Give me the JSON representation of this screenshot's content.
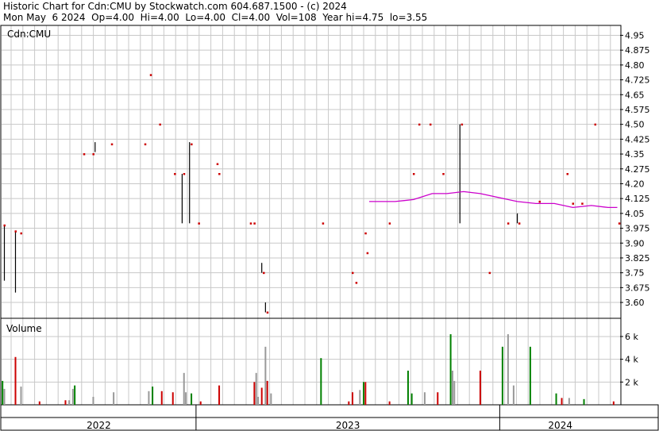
{
  "header": {
    "line1": "Historic Chart for Cdn:CMU by Stockwatch.com 604.687.1500 - (c) 2024",
    "line2": "Mon May  6 2024  Op=4.00  Hi=4.00  Lo=4.00  Cl=4.00  Vol=108  Year hi=4.75  lo=3.55"
  },
  "colors": {
    "up": "#008000",
    "down": "#cc0000",
    "neutral": "#999999",
    "price_bar": "#000000",
    "price_dot": "#cc0000",
    "moving_average": "#cc00cc",
    "grid": "#c8c8c8"
  },
  "chart_data": {
    "type": "bar",
    "symbol_label": "Cdn:CMU",
    "price_panel": {
      "ylim": [
        3.52,
        5.0
      ],
      "yticks": [
        "3.60",
        "3.675",
        "3.75",
        "3.825",
        "3.90",
        "3.975",
        "4.05",
        "4.125",
        "4.20",
        "4.275",
        "4.35",
        "4.425",
        "4.50",
        "4.575",
        "4.65",
        "4.725",
        "4.80",
        "4.875",
        "4.95"
      ],
      "bars": [
        {
          "idx": 1,
          "high": 3.99,
          "low": 3.71
        },
        {
          "idx": 7,
          "high": 3.96,
          "low": 3.65
        },
        {
          "idx": 50,
          "high": 4.41,
          "low": 4.36
        },
        {
          "idx": 97,
          "high": 4.25,
          "low": 4.0
        },
        {
          "idx": 101,
          "high": 4.41,
          "low": 4.0
        },
        {
          "idx": 140,
          "high": 3.8,
          "low": 3.75
        },
        {
          "idx": 142,
          "high": 3.6,
          "low": 3.55
        },
        {
          "idx": 247,
          "high": 4.5,
          "low": 4.0
        },
        {
          "idx": 278,
          "high": 4.05,
          "low": 4.0
        }
      ],
      "closes": [
        {
          "idx": 1,
          "close": 3.99
        },
        {
          "idx": 7,
          "close": 3.96
        },
        {
          "idx": 10,
          "close": 3.95
        },
        {
          "idx": 44,
          "close": 4.35
        },
        {
          "idx": 49,
          "close": 4.35
        },
        {
          "idx": 59,
          "close": 4.4
        },
        {
          "idx": 77,
          "close": 4.4
        },
        {
          "idx": 80,
          "close": 4.75
        },
        {
          "idx": 85,
          "close": 4.5
        },
        {
          "idx": 93,
          "close": 4.25
        },
        {
          "idx": 98,
          "close": 4.25
        },
        {
          "idx": 102,
          "close": 4.4
        },
        {
          "idx": 106,
          "close": 4.0
        },
        {
          "idx": 116,
          "close": 4.3
        },
        {
          "idx": 117,
          "close": 4.25
        },
        {
          "idx": 134,
          "close": 4.0
        },
        {
          "idx": 136,
          "close": 4.0
        },
        {
          "idx": 141,
          "close": 3.75
        },
        {
          "idx": 143,
          "close": 3.55
        },
        {
          "idx": 173,
          "close": 4.0
        },
        {
          "idx": 189,
          "close": 3.75
        },
        {
          "idx": 191,
          "close": 3.7
        },
        {
          "idx": 196,
          "close": 3.95
        },
        {
          "idx": 197,
          "close": 3.85
        },
        {
          "idx": 209,
          "close": 4.0
        },
        {
          "idx": 222,
          "close": 4.25
        },
        {
          "idx": 225,
          "close": 4.5
        },
        {
          "idx": 231,
          "close": 4.5
        },
        {
          "idx": 238,
          "close": 4.25
        },
        {
          "idx": 248,
          "close": 4.5
        },
        {
          "idx": 263,
          "close": 3.75
        },
        {
          "idx": 273,
          "close": 4.0
        },
        {
          "idx": 279,
          "close": 4.0
        },
        {
          "idx": 290,
          "close": 4.11
        },
        {
          "idx": 305,
          "close": 4.25
        },
        {
          "idx": 308,
          "close": 4.1
        },
        {
          "idx": 313,
          "close": 4.1
        },
        {
          "idx": 320,
          "close": 4.5
        },
        {
          "idx": 333,
          "close": 4.0
        }
      ],
      "moving_average": [
        {
          "idx": 198,
          "value": 4.11
        },
        {
          "idx": 212,
          "value": 4.11
        },
        {
          "idx": 222,
          "value": 4.12
        },
        {
          "idx": 232,
          "value": 4.15
        },
        {
          "idx": 240,
          "value": 4.15
        },
        {
          "idx": 249,
          "value": 4.16
        },
        {
          "idx": 258,
          "value": 4.15
        },
        {
          "idx": 268,
          "value": 4.13
        },
        {
          "idx": 278,
          "value": 4.11
        },
        {
          "idx": 288,
          "value": 4.1
        },
        {
          "idx": 298,
          "value": 4.1
        },
        {
          "idx": 308,
          "value": 4.08
        },
        {
          "idx": 318,
          "value": 4.09
        },
        {
          "idx": 327,
          "value": 4.08
        },
        {
          "idx": 332,
          "value": 4.08
        }
      ]
    },
    "volume_panel": {
      "label": "Volume",
      "ylim": [
        0,
        7600
      ],
      "ytick_values": [
        2000,
        4000,
        6000
      ],
      "ytick_labels": [
        "2 k",
        "4 k",
        "6 k"
      ],
      "bars": [
        {
          "idx": 0,
          "volume": 2100,
          "dir": "up"
        },
        {
          "idx": 1,
          "volume": 1400,
          "dir": "neutral"
        },
        {
          "idx": 7,
          "volume": 4200,
          "dir": "down"
        },
        {
          "idx": 10,
          "volume": 1600,
          "dir": "neutral"
        },
        {
          "idx": 20,
          "volume": 300,
          "dir": "down"
        },
        {
          "idx": 34,
          "volume": 400,
          "dir": "down"
        },
        {
          "idx": 36,
          "volume": 400,
          "dir": "neutral"
        },
        {
          "idx": 38,
          "volume": 1400,
          "dir": "neutral"
        },
        {
          "idx": 39,
          "volume": 1700,
          "dir": "up"
        },
        {
          "idx": 49,
          "volume": 700,
          "dir": "neutral"
        },
        {
          "idx": 60,
          "volume": 1100,
          "dir": "neutral"
        },
        {
          "idx": 79,
          "volume": 1200,
          "dir": "neutral"
        },
        {
          "idx": 81,
          "volume": 1600,
          "dir": "up"
        },
        {
          "idx": 86,
          "volume": 1200,
          "dir": "down"
        },
        {
          "idx": 92,
          "volume": 1100,
          "dir": "down"
        },
        {
          "idx": 98,
          "volume": 2800,
          "dir": "neutral"
        },
        {
          "idx": 99,
          "volume": 1100,
          "dir": "neutral"
        },
        {
          "idx": 102,
          "volume": 1000,
          "dir": "up"
        },
        {
          "idx": 107,
          "volume": 300,
          "dir": "down"
        },
        {
          "idx": 117,
          "volume": 1700,
          "dir": "down"
        },
        {
          "idx": 136,
          "volume": 2000,
          "dir": "down"
        },
        {
          "idx": 137,
          "volume": 2800,
          "dir": "neutral"
        },
        {
          "idx": 138,
          "volume": 700,
          "dir": "neutral"
        },
        {
          "idx": 140,
          "volume": 1500,
          "dir": "down"
        },
        {
          "idx": 142,
          "volume": 5100,
          "dir": "neutral"
        },
        {
          "idx": 143,
          "volume": 2100,
          "dir": "down"
        },
        {
          "idx": 145,
          "volume": 1000,
          "dir": "neutral"
        },
        {
          "idx": 172,
          "volume": 4100,
          "dir": "up"
        },
        {
          "idx": 187,
          "volume": 300,
          "dir": "down"
        },
        {
          "idx": 189,
          "volume": 1100,
          "dir": "down"
        },
        {
          "idx": 193,
          "volume": 1300,
          "dir": "neutral"
        },
        {
          "idx": 195,
          "volume": 2000,
          "dir": "up"
        },
        {
          "idx": 196,
          "volume": 2000,
          "dir": "down"
        },
        {
          "idx": 209,
          "volume": 300,
          "dir": "down"
        },
        {
          "idx": 219,
          "volume": 3000,
          "dir": "up"
        },
        {
          "idx": 221,
          "volume": 1000,
          "dir": "up"
        },
        {
          "idx": 228,
          "volume": 1100,
          "dir": "neutral"
        },
        {
          "idx": 235,
          "volume": 1100,
          "dir": "down"
        },
        {
          "idx": 242,
          "volume": 6200,
          "dir": "up"
        },
        {
          "idx": 243,
          "volume": 3000,
          "dir": "neutral"
        },
        {
          "idx": 244,
          "volume": 2100,
          "dir": "neutral"
        },
        {
          "idx": 258,
          "volume": 3000,
          "dir": "down"
        },
        {
          "idx": 270,
          "volume": 5100,
          "dir": "up"
        },
        {
          "idx": 273,
          "volume": 6200,
          "dir": "neutral"
        },
        {
          "idx": 276,
          "volume": 1700,
          "dir": "neutral"
        },
        {
          "idx": 285,
          "volume": 5100,
          "dir": "up"
        },
        {
          "idx": 299,
          "volume": 1000,
          "dir": "up"
        },
        {
          "idx": 302,
          "volume": 600,
          "dir": "down"
        },
        {
          "idx": 306,
          "volume": 600,
          "dir": "neutral"
        },
        {
          "idx": 314,
          "volume": 500,
          "dir": "up"
        },
        {
          "idx": 330,
          "volume": 300,
          "dir": "down"
        }
      ]
    },
    "x_axis": {
      "count": 334,
      "year_labels": [
        {
          "label": "2022",
          "start": 0,
          "end": 105
        },
        {
          "label": "2023",
          "start": 105,
          "end": 269
        },
        {
          "label": "2024",
          "start": 269,
          "end": 334
        }
      ]
    }
  }
}
